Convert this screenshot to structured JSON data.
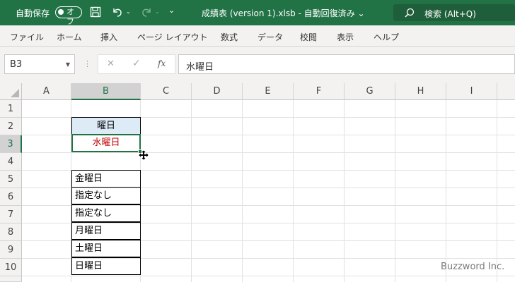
{
  "titlebar": {
    "autosave_label": "自動保存",
    "autosave_state": "オフ",
    "doc_title": "成績表 (version 1).xlsb  -  自動回復済み ⌄",
    "search_placeholder": "検索 (Alt+Q)",
    "icons": [
      "save-icon",
      "undo-icon",
      "redo-icon",
      "customize-icon",
      "search-icon"
    ]
  },
  "menu": {
    "items": [
      "ファイル",
      "ホーム",
      "挿入",
      "ページ レイアウト",
      "数式",
      "データ",
      "校閲",
      "表示",
      "ヘルプ"
    ]
  },
  "formula_bar": {
    "name_box": "B3",
    "formula": "水曜日",
    "cancel_symbol": "✕",
    "enter_symbol": "✓",
    "fx_label": "fx"
  },
  "grid": {
    "columns": [
      "A",
      "B",
      "C",
      "D",
      "E",
      "F",
      "G",
      "H",
      "I"
    ],
    "rows": [
      "1",
      "2",
      "3",
      "4",
      "5",
      "6",
      "7",
      "8",
      "9",
      "10"
    ],
    "selected_column": "B",
    "selected_row": "3",
    "cells": {
      "B2": "曜日",
      "B3": "水曜日",
      "B4": "金曜日",
      "B5": "指定なし",
      "B6": "指定なし",
      "B7": "月曜日",
      "B8": "土曜日",
      "B9": "日曜日"
    }
  },
  "colors": {
    "accent": "#217346",
    "header_fill": "#ddebf7",
    "active_text": "#c00000"
  },
  "watermark": "Buzzword Inc."
}
